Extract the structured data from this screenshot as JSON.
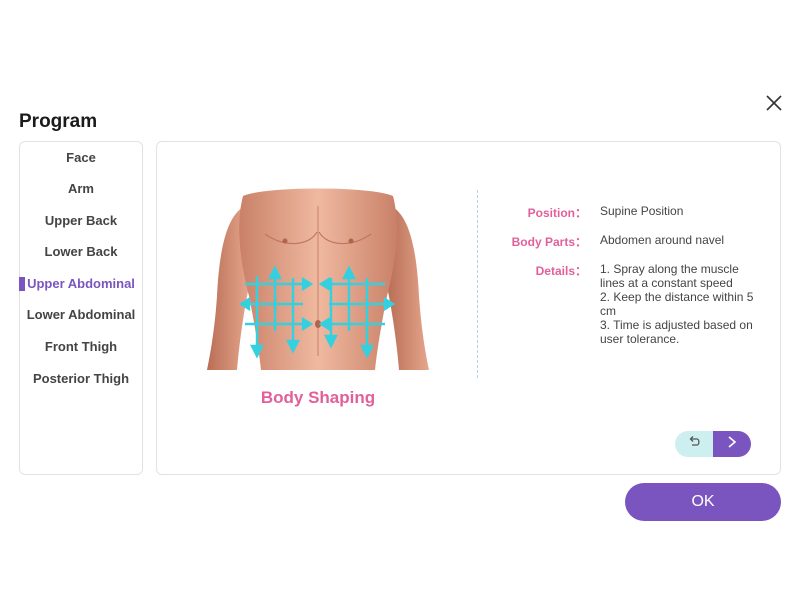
{
  "header": {
    "title": "Program"
  },
  "sidebar": {
    "items": [
      {
        "label": "Face"
      },
      {
        "label": "Arm"
      },
      {
        "label": "Upper Back"
      },
      {
        "label": "Lower Back"
      },
      {
        "label": "Upper Abdominal",
        "active": true
      },
      {
        "label": "Lower Abdominal"
      },
      {
        "label": "Front Thigh"
      },
      {
        "label": "Posterior Thigh"
      }
    ]
  },
  "main": {
    "caption": "Body Shaping",
    "info": {
      "position_label": "Position：",
      "position_value": "Supine Position",
      "body_parts_label": "Body Parts：",
      "body_parts_value": "Abdomen around navel",
      "details_label": "Details：",
      "details_lines": [
        "1. Spray along the muscle lines at a constant speed",
        "2. Keep the distance within 5 cm",
        "3. Time is adjusted based on user tolerance."
      ]
    },
    "nav": {
      "back_icon": "undo-icon",
      "next_icon": "chevron-right-icon"
    }
  },
  "footer": {
    "ok_label": "OK"
  },
  "colors": {
    "accent": "#7a55c0",
    "pink": "#e2609a",
    "cyan": "#35d0e0",
    "skin": "#e6a78e"
  }
}
